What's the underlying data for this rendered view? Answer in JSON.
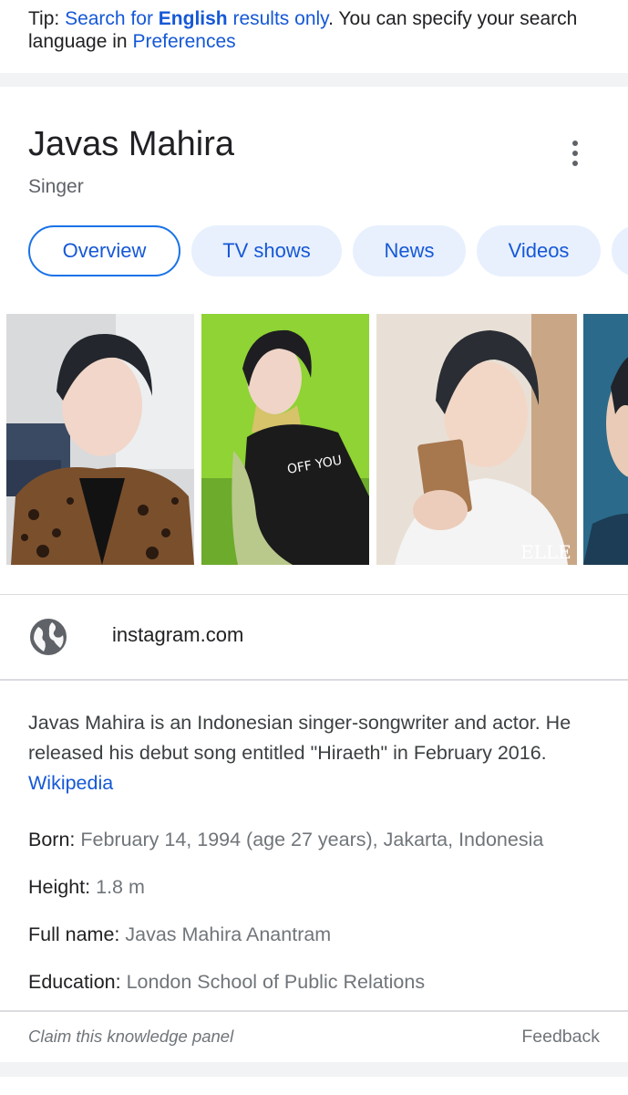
{
  "tip": {
    "prefix": "Tip: ",
    "search_link_a": "Search for ",
    "search_link_bold": "English",
    "search_link_b": " results only",
    "middle": ". You can specify your search language in ",
    "preferences_link": "Preferences"
  },
  "panel": {
    "title": "Javas Mahira",
    "subtitle": "Singer"
  },
  "tabs": [
    {
      "label": "Overview",
      "active": true
    },
    {
      "label": "TV shows",
      "active": false
    },
    {
      "label": "News",
      "active": false
    },
    {
      "label": "Videos",
      "active": false
    }
  ],
  "image_watermark": "ELLE",
  "website": {
    "icon": "globe-icon",
    "label": "instagram.com"
  },
  "description": {
    "text": "Javas Mahira is an Indonesian singer-songwriter and actor. He released his debut song entitled \"Hiraeth\" in February 2016. ",
    "source_link": "Wikipedia"
  },
  "facts": [
    {
      "label": "Born:",
      "value": "February 14, 1994 (age 27 years), Jakarta, Indonesia"
    },
    {
      "label": "Height:",
      "value": "1.8 m"
    },
    {
      "label": "Full name:",
      "value": "Javas Mahira Anantram"
    },
    {
      "label": "Education:",
      "value": "London School of Public Relations"
    }
  ],
  "footer": {
    "claim": "Claim this knowledge panel",
    "feedback": "Feedback"
  },
  "colors": {
    "link": "#1558d6",
    "chip_bg": "#e8f0fe",
    "chip_active_border": "#1a73e8",
    "muted_text": "#70757a"
  }
}
